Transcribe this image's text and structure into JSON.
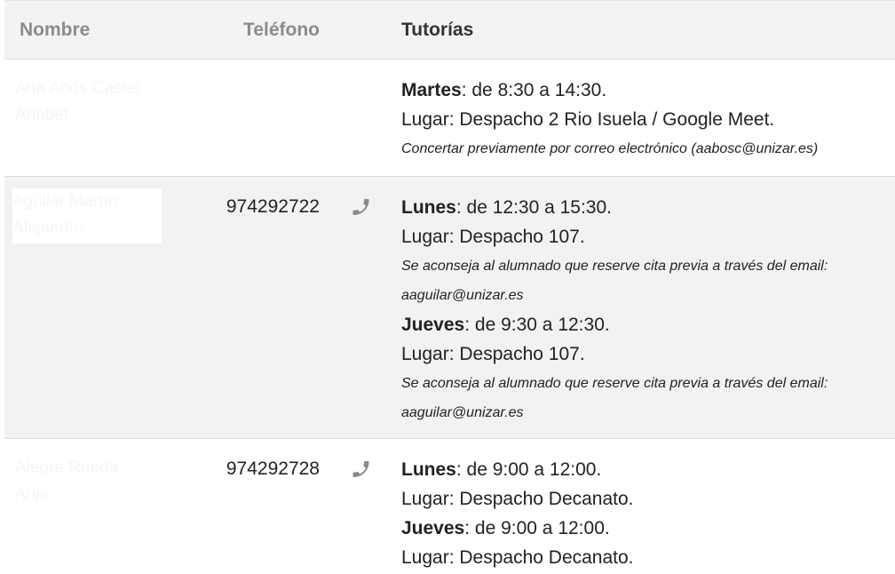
{
  "headers": {
    "nombre": "Nombre",
    "telefono": "Teléfono",
    "tutorias": "Tutorías"
  },
  "rows": [
    {
      "name_lines": [
        "Ana Abós Castel",
        "Anabel"
      ],
      "phone": "",
      "slots": [
        {
          "day": "Martes",
          "hours": ": de 8:30 a 14:30.",
          "place": "Lugar: Despacho 2 Rio Isuela / Google Meet.",
          "notes": [
            "Concertar previamente por correo electrónico (aabosc@unizar.es)"
          ]
        }
      ]
    },
    {
      "name_lines": [
        "Aguilar Martín",
        "Alejandro"
      ],
      "phone": "974292722",
      "slots": [
        {
          "day": "Lunes",
          "hours": ": de 12:30 a 15:30.",
          "place": "Lugar: Despacho 107.",
          "notes": [
            "Se aconseja al alumnado que reserve cita previa a través del email:",
            "aaguilar@unizar.es"
          ]
        },
        {
          "day": "Jueves",
          "hours": ": de 9:30 a 12:30.",
          "place": "Lugar: Despacho 107.",
          "notes": [
            "Se aconseja al alumnado que reserve cita previa a través del email:",
            "aaguilar@unizar.es"
          ]
        }
      ]
    },
    {
      "name_lines": [
        "Alegre Rueda",
        "Arija"
      ],
      "phone": "974292728",
      "slots": [
        {
          "day": "Lunes",
          "hours": ": de 9:00 a 12:00.",
          "place": "Lugar: Despacho Decanato.",
          "notes": []
        },
        {
          "day": "Jueves",
          "hours": ": de 9:00 a 12:00.",
          "place": "Lugar: Despacho Decanato.",
          "notes": []
        }
      ]
    }
  ],
  "icons": {
    "phone": "phone-icon"
  },
  "colors": {
    "header_bg": "#f3f3f3",
    "header_muted_text": "#8c8c8c",
    "alt_row_bg": "#f2f2f2",
    "icon": "#8a8a8a"
  }
}
